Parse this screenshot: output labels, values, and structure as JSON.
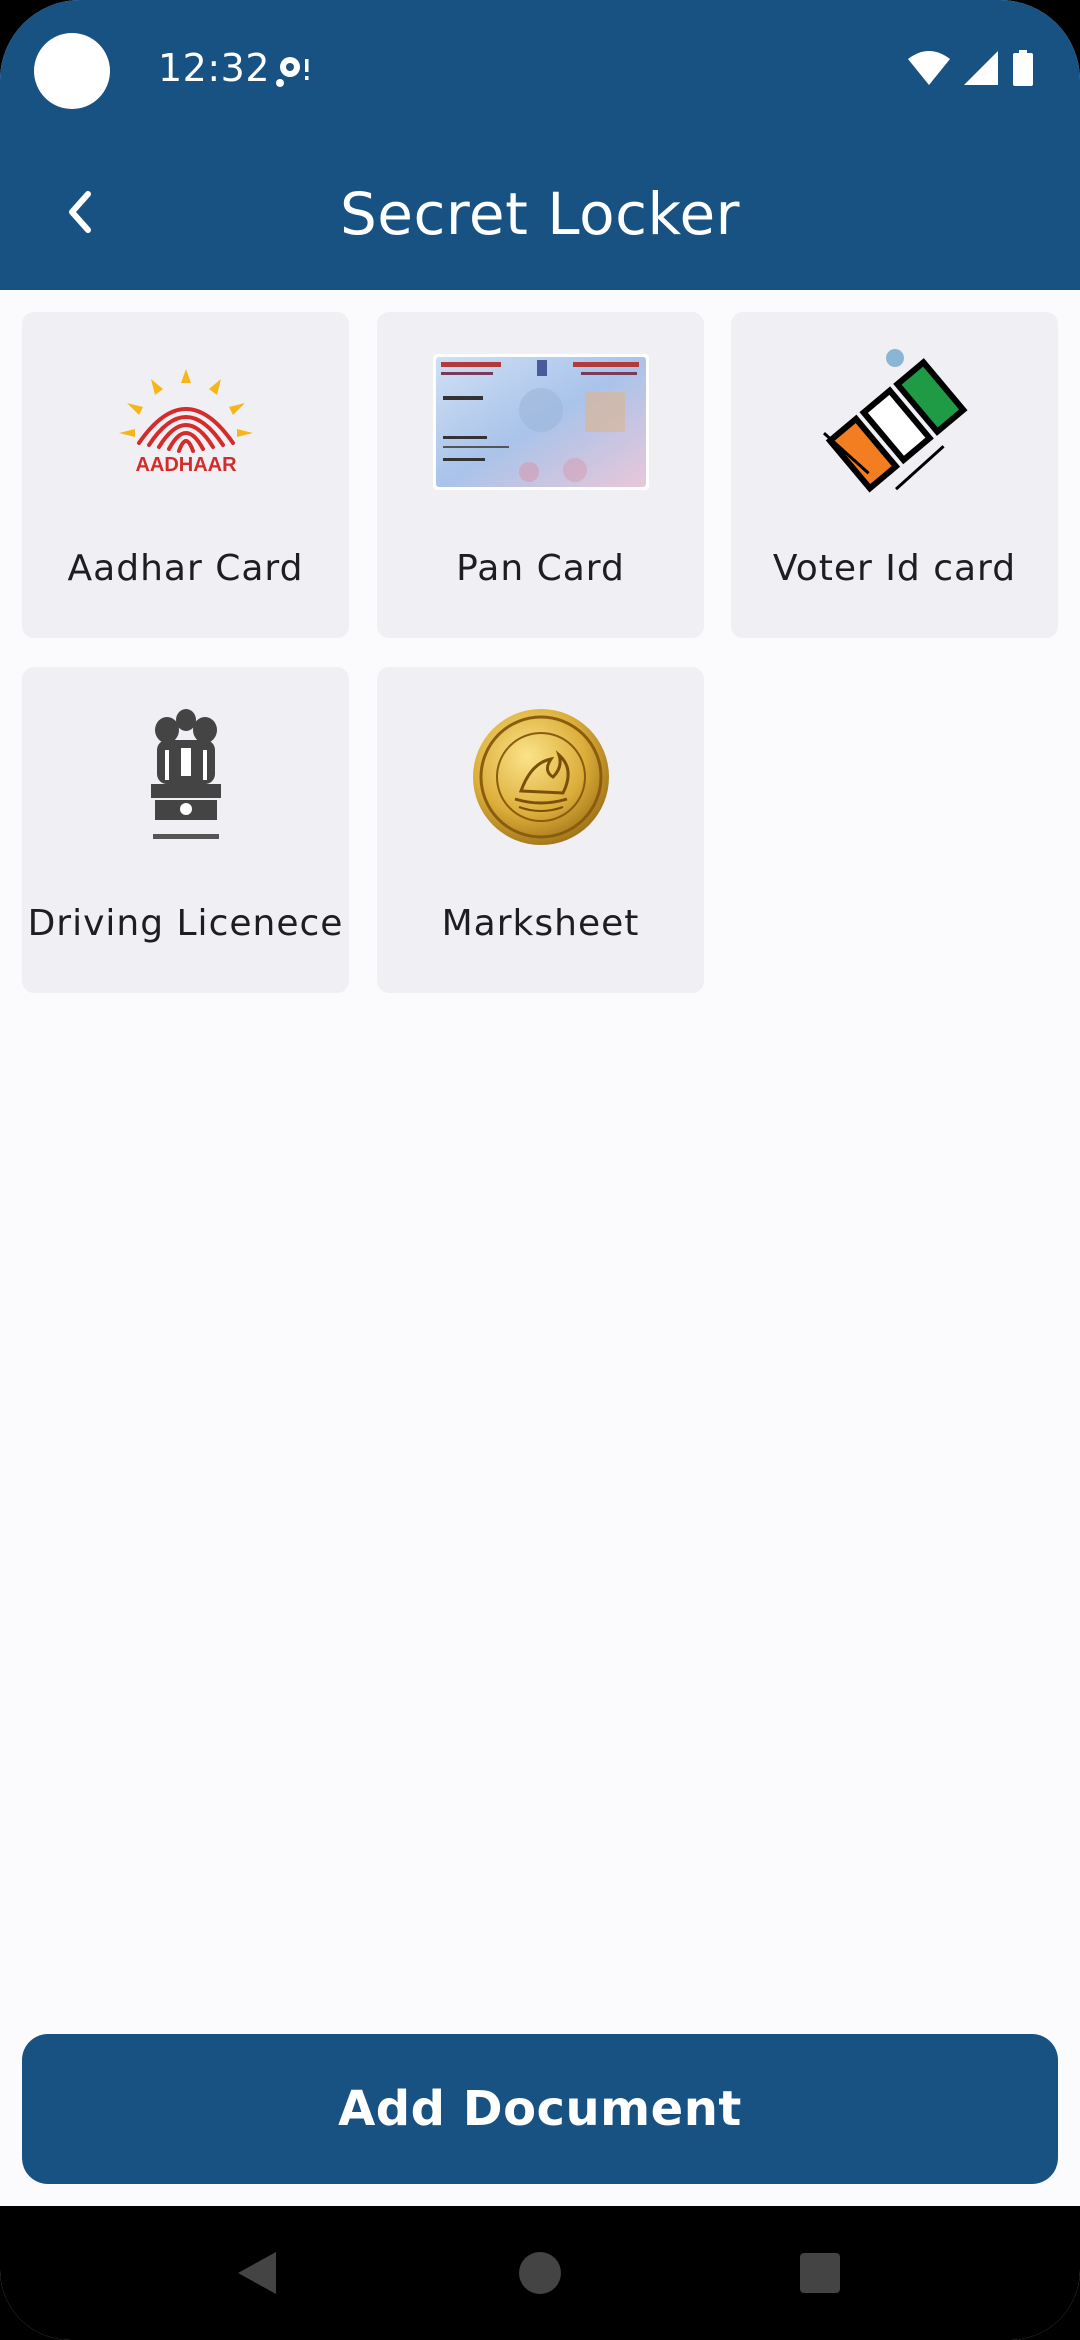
{
  "status_bar": {
    "time": "12:32"
  },
  "app_bar": {
    "title": "Secret Locker",
    "back_icon": "chevron-left-icon"
  },
  "documents": [
    {
      "label": "Aadhar Card",
      "icon": "aadhaar-logo",
      "logo_text": "AADHAAR"
    },
    {
      "label": "Pan Card",
      "icon": "pan-card-image"
    },
    {
      "label": "Voter Id card",
      "icon": "election-commission-logo"
    },
    {
      "label": "Driving Licenece",
      "icon": "national-emblem-icon"
    },
    {
      "label": "Marksheet",
      "icon": "board-seal-icon"
    }
  ],
  "add_button": {
    "label": "Add Document"
  },
  "colors": {
    "primary": "#185283",
    "tile": "#f0eff3",
    "background": "#fbfbfd"
  }
}
